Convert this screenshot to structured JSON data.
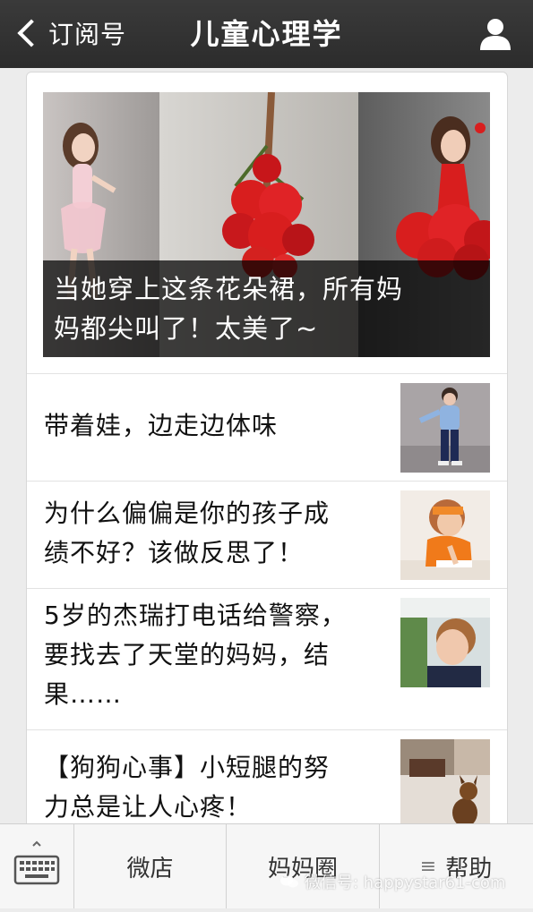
{
  "header": {
    "back_label": "订阅号",
    "title": "儿童心理学"
  },
  "featured": {
    "caption_line1": "当她穿上这条花朵裙，所有妈",
    "caption_line2": "妈都尖叫了！太美了~"
  },
  "articles": [
    {
      "lines": [
        "带着娃，边走边体味"
      ]
    },
    {
      "lines": [
        "为什么偏偏是你的孩子成",
        "绩不好？该做反思了！"
      ]
    },
    {
      "lines": [
        "5岁的杰瑞打电话给警察，",
        "要找去了天堂的妈妈，结",
        "果……"
      ]
    },
    {
      "lines": [
        "【狗狗心事】小短腿的努",
        "力总是让人心疼！"
      ]
    }
  ],
  "menu": {
    "items": [
      {
        "label": "微店"
      },
      {
        "label": "妈妈圈"
      },
      {
        "label": "帮助"
      }
    ]
  },
  "watermark": "微信号: happystar61-com",
  "colors": {
    "topbar": "#2f2f2f",
    "dress_red": "#d81e1e",
    "caption_bg": "#000000"
  },
  "icons": [
    "back-chevron-icon",
    "profile-icon",
    "keyboard-icon",
    "menu-lines-icon",
    "wechat-logo-icon"
  ]
}
